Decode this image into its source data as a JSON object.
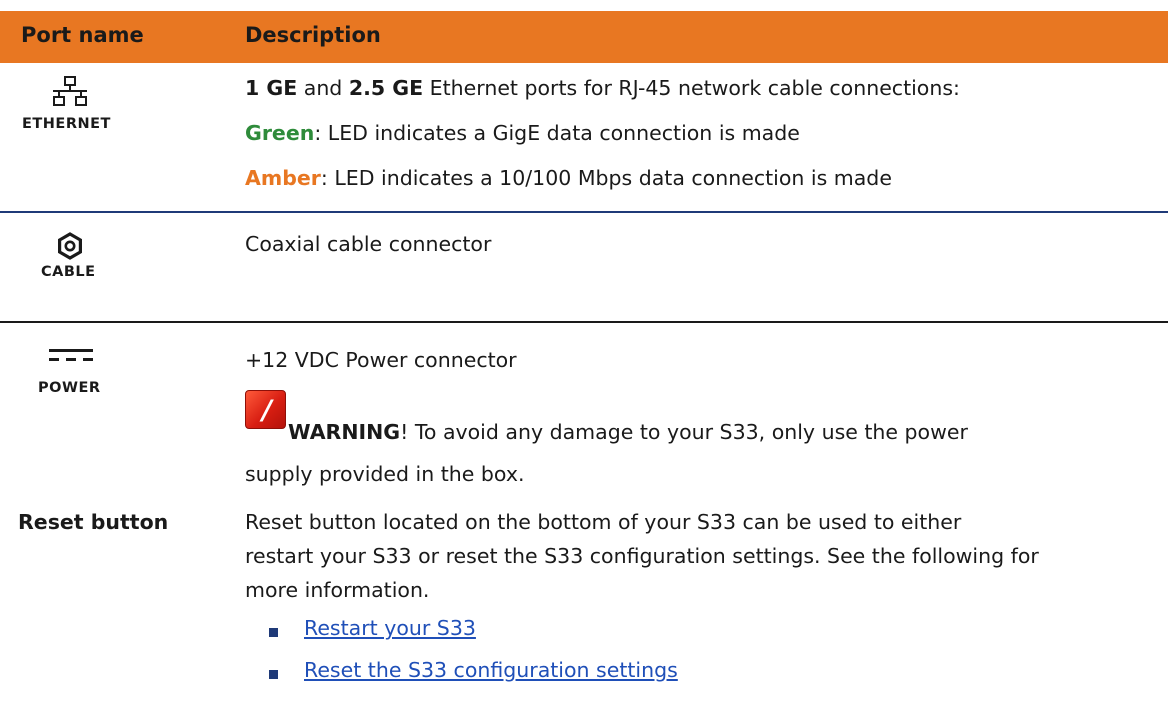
{
  "header": {
    "col1": "Port name",
    "col2": "Description"
  },
  "rows": {
    "ethernet": {
      "icon_label": "ETHERNET",
      "line1_b1": "1 GE",
      "line1_t1": " and ",
      "line1_b2": "2.5 GE",
      "line1_t2": " Ethernet ports for RJ-45 network cable connections:",
      "green_word": "Green",
      "green_rest": ": LED indicates a GigE data connection is made",
      "amber_word": "Amber",
      "amber_rest": ": LED indicates a 10/100 Mbps data connection is made"
    },
    "cable": {
      "icon_label": "CABLE",
      "desc": "Coaxial cable connector"
    },
    "power": {
      "icon_label": "POWER",
      "desc": "+12 VDC Power connector",
      "warn_word": "WARNING",
      "warn_rest": "! To avoid any damage to your S33, only use the power",
      "warn_line2": "supply provided in the box."
    },
    "reset": {
      "name": "Reset button",
      "desc_line1": "Reset button located on the bottom of your S33 can be used to either",
      "desc_line2": "restart your S33 or reset the S33 configuration settings. See the following for",
      "desc_line3": "more information.",
      "links": [
        "Restart your S33",
        "Reset the S33 configuration settings"
      ]
    }
  },
  "colors": {
    "header_bg": "#e87722",
    "green": "#2e8b3a",
    "amber": "#e87722",
    "rule_blue": "#1f3a78",
    "link": "#1f4fb8"
  },
  "icons": [
    "ethernet-icon",
    "cable-icon",
    "power-icon",
    "warning-icon",
    "bullet-icon"
  ]
}
